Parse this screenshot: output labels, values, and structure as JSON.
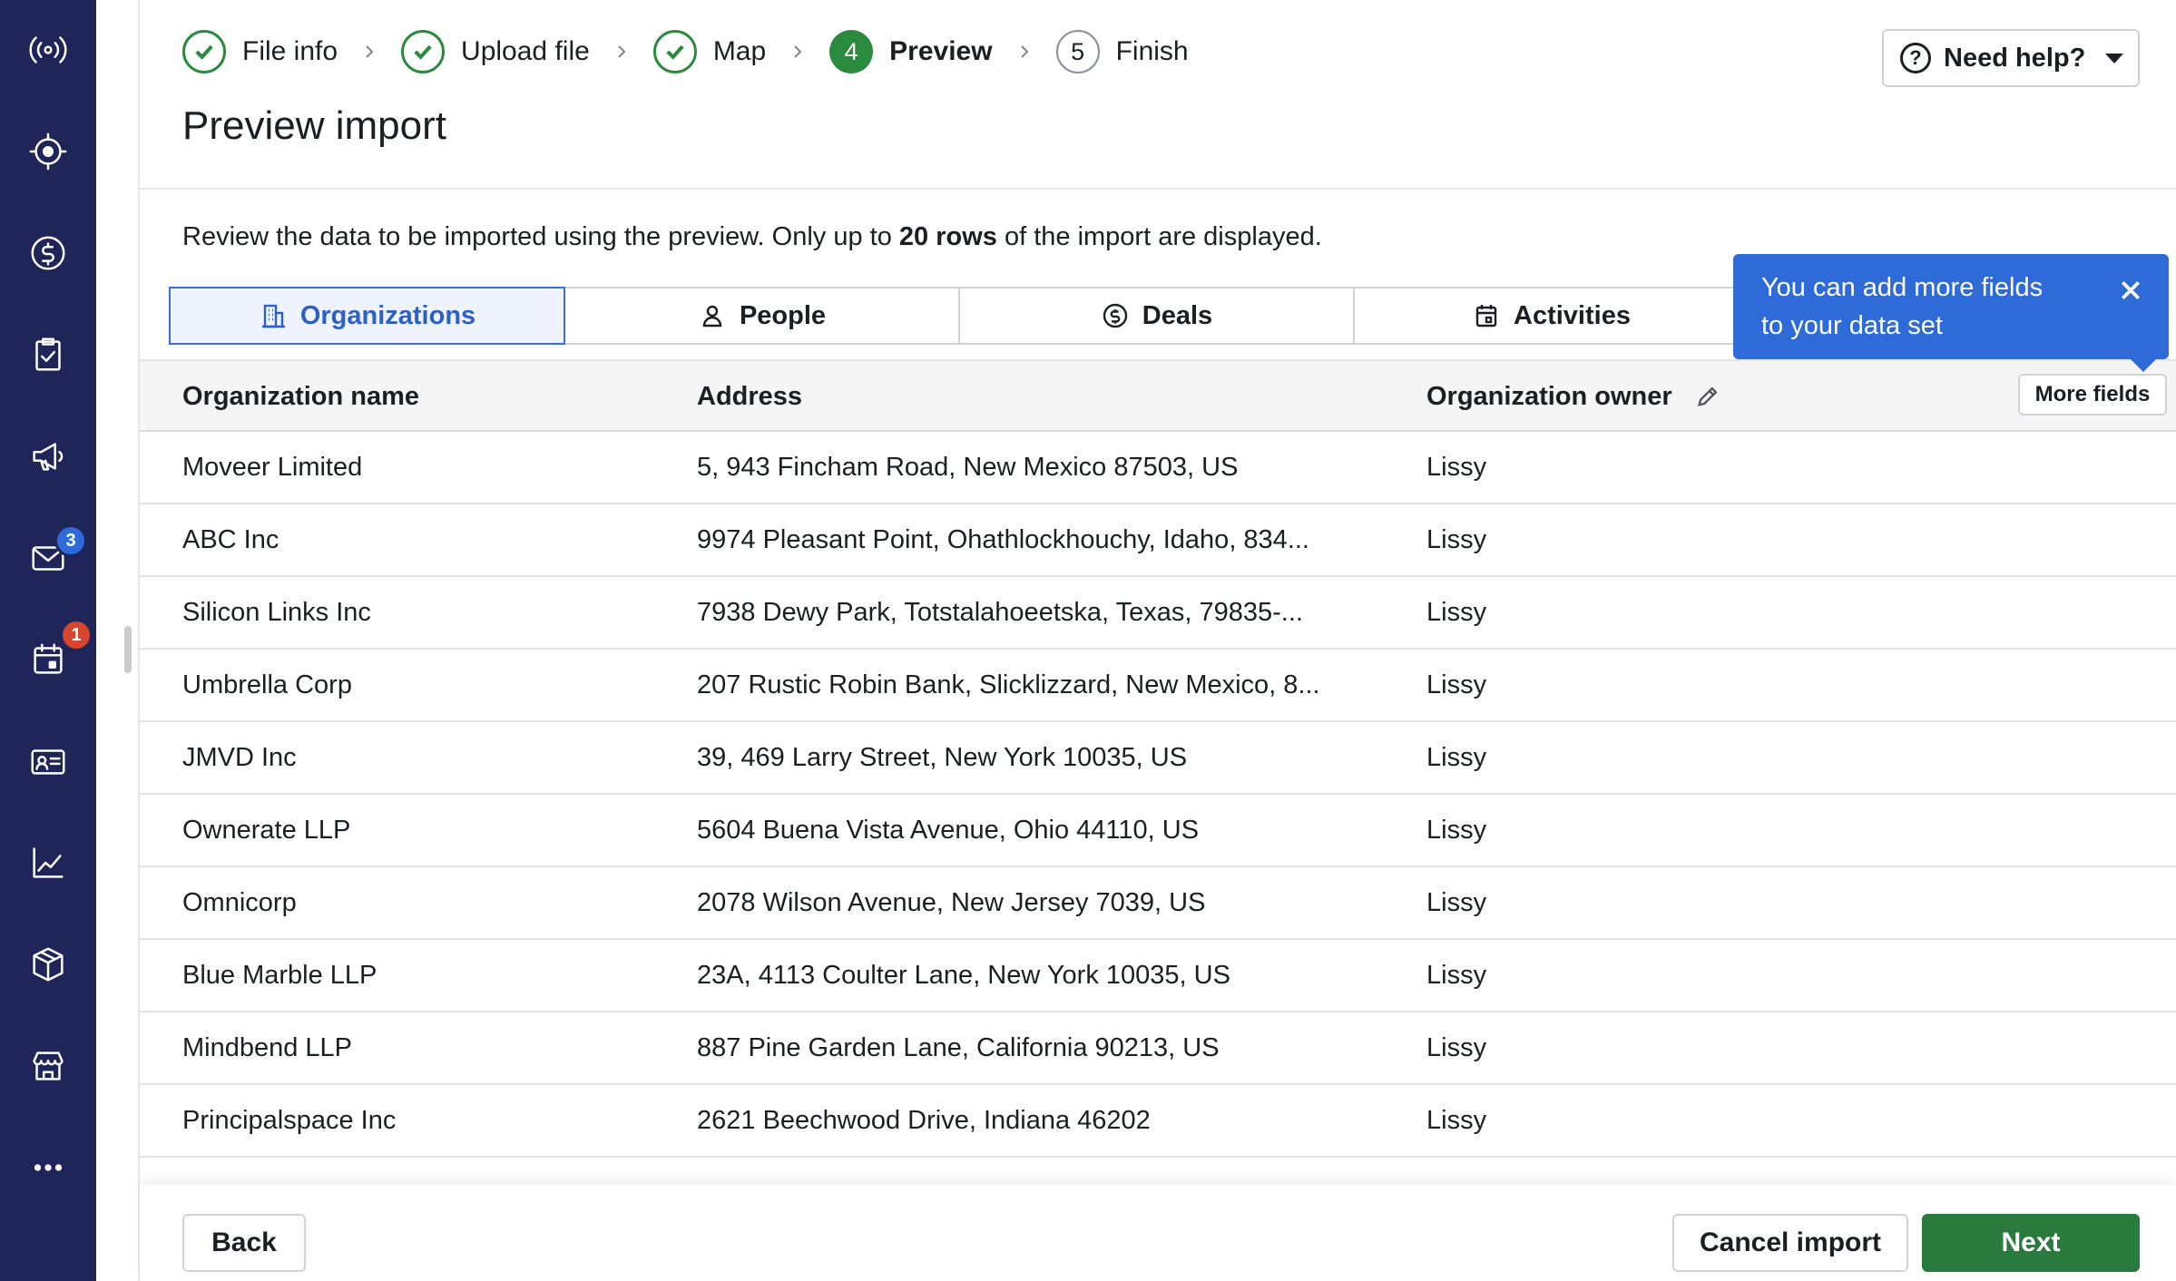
{
  "sidebar": {
    "items": [
      {
        "name": "radar-icon"
      },
      {
        "name": "target-icon"
      },
      {
        "name": "dollar-icon"
      },
      {
        "name": "clipboard-check-icon"
      },
      {
        "name": "megaphone-icon"
      },
      {
        "name": "mail-icon",
        "badge": "3"
      },
      {
        "name": "calendar-icon",
        "badge": "1"
      },
      {
        "name": "contact-card-icon"
      },
      {
        "name": "chart-icon"
      },
      {
        "name": "box-icon"
      },
      {
        "name": "store-icon"
      },
      {
        "name": "more-icon"
      }
    ]
  },
  "stepper": {
    "steps": [
      {
        "label": "File info",
        "state": "done"
      },
      {
        "label": "Upload file",
        "state": "done"
      },
      {
        "label": "Map",
        "state": "done"
      },
      {
        "number": "4",
        "label": "Preview",
        "state": "active"
      },
      {
        "number": "5",
        "label": "Finish",
        "state": "todo"
      }
    ]
  },
  "help": {
    "label": "Need help?"
  },
  "page": {
    "title": "Preview import",
    "description_prefix": "Review the data to be imported using the preview. Only up to ",
    "description_bold": "20 rows",
    "description_suffix": " of the import are displayed."
  },
  "tabs": [
    {
      "label": "Organizations",
      "icon": "building-icon",
      "active": true
    },
    {
      "label": "People",
      "icon": "person-icon",
      "active": false
    },
    {
      "label": "Deals",
      "icon": "dollar-icon",
      "active": false
    },
    {
      "label": "Activities",
      "icon": "calendar-icon",
      "active": false
    }
  ],
  "tooltip": {
    "text_line1": "You can add more fields",
    "text_line2": "to your data set"
  },
  "table": {
    "columns": [
      "Organization name",
      "Address",
      "Organization owner"
    ],
    "more_fields_label": "More fields",
    "rows": [
      [
        "Moveer Limited",
        "5, 943 Fincham Road, New Mexico 87503, US",
        "Lissy"
      ],
      [
        "ABC Inc",
        "9974 Pleasant Point, Ohathlockhouchy, Idaho, 834...",
        "Lissy"
      ],
      [
        "Silicon Links Inc",
        "7938 Dewy Park, Totstalahoeetska, Texas, 79835-...",
        "Lissy"
      ],
      [
        "Umbrella Corp",
        "207 Rustic Robin Bank, Slicklizzard, New Mexico, 8...",
        "Lissy"
      ],
      [
        "JMVD Inc",
        "39, 469 Larry Street, New York 10035, US",
        "Lissy"
      ],
      [
        "Ownerate LLP",
        "5604 Buena Vista Avenue, Ohio 44110, US",
        "Lissy"
      ],
      [
        "Omnicorp",
        "2078 Wilson Avenue, New Jersey 7039, US",
        "Lissy"
      ],
      [
        "Blue Marble LLP",
        "23A, 4113 Coulter Lane, New York 10035, US",
        "Lissy"
      ],
      [
        "Mindbend LLP",
        "887 Pine Garden Lane, California 90213, US",
        "Lissy"
      ],
      [
        "Principalspace Inc",
        "2621 Beechwood Drive, Indiana 46202",
        "Lissy"
      ]
    ]
  },
  "footer": {
    "back_label": "Back",
    "cancel_label": "Cancel import",
    "next_label": "Next"
  },
  "colors": {
    "sidebar": "#1f2559",
    "accent_green": "#2a8a3e",
    "accent_blue": "#2e6bd8",
    "badge_red": "#d6452c"
  }
}
